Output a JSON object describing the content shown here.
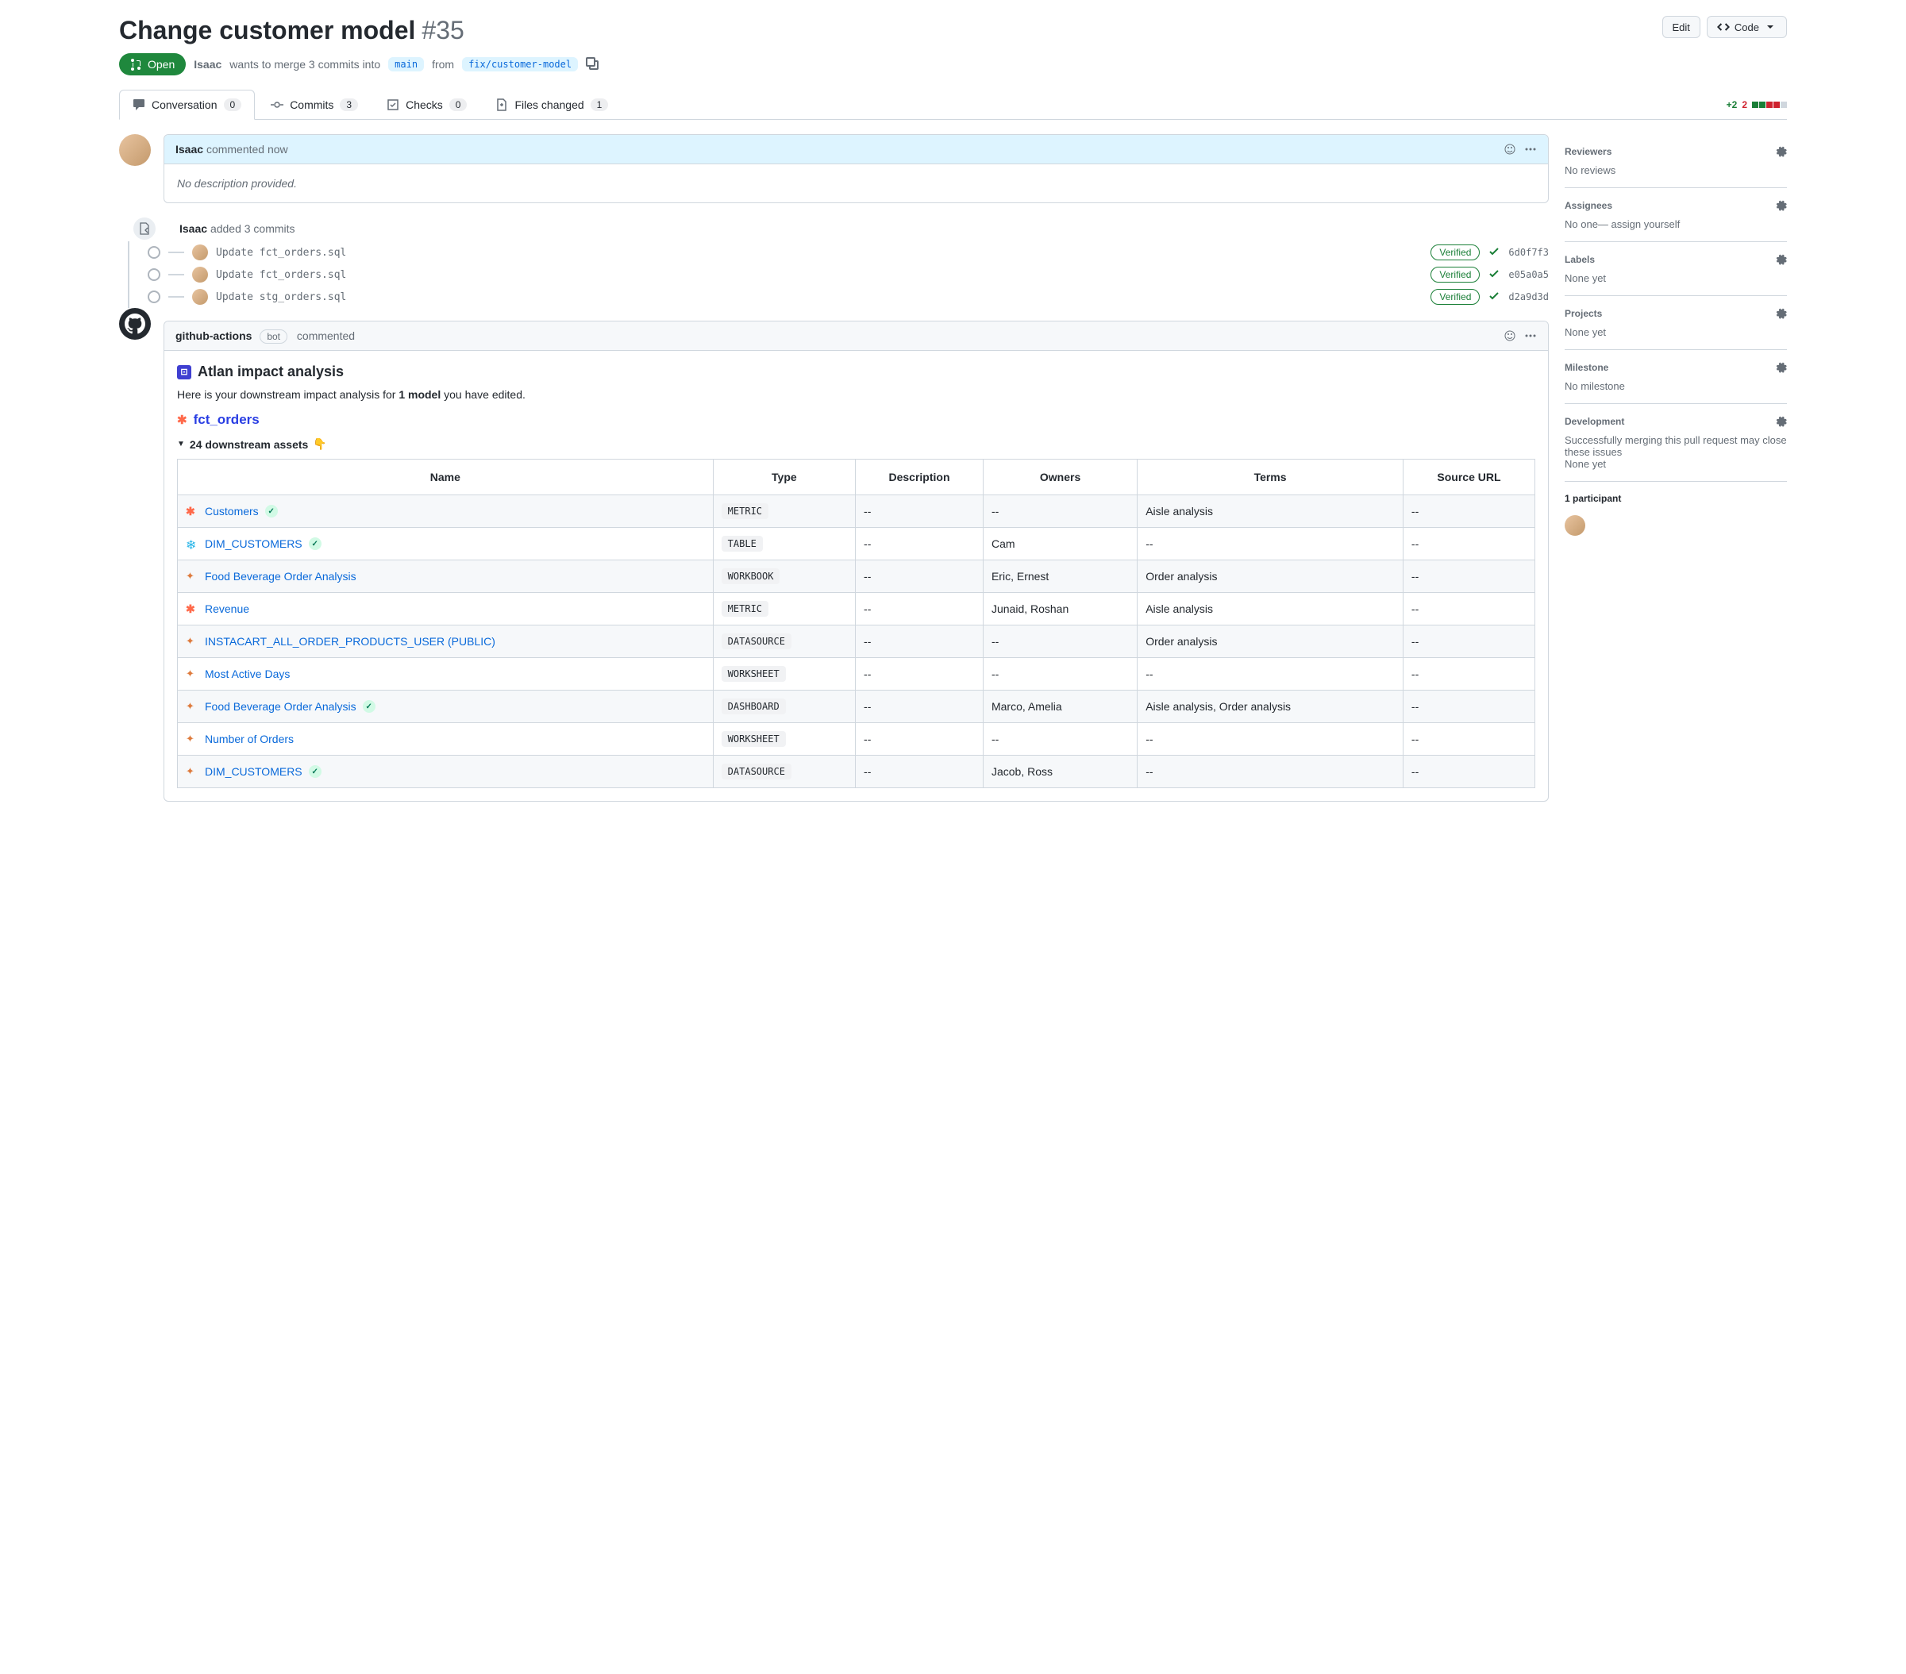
{
  "header": {
    "title": "Change customer model",
    "number": "#35",
    "edit_btn": "Edit",
    "code_btn": "Code",
    "state": "Open",
    "author": "Isaac",
    "merge_text_1": "wants to merge 3 commits into",
    "target_branch": "main",
    "from_text": "from",
    "source_branch": "fix/customer-model"
  },
  "tabs": {
    "conversation": {
      "label": "Conversation",
      "count": "0"
    },
    "commits": {
      "label": "Commits",
      "count": "3"
    },
    "checks": {
      "label": "Checks",
      "count": "0"
    },
    "files": {
      "label": "Files changed",
      "count": "1"
    },
    "diff_add": "+2",
    "diff_del": "2"
  },
  "first_comment": {
    "author": "Isaac",
    "time": "commented now",
    "body": "No description provided."
  },
  "commits_event": {
    "author": "Isaac",
    "text": "added 3 commits"
  },
  "commits": [
    {
      "msg": "Update fct_orders.sql",
      "verified": "Verified",
      "sha": "6d0f7f3"
    },
    {
      "msg": "Update fct_orders.sql",
      "verified": "Verified",
      "sha": "e05a0a5"
    },
    {
      "msg": "Update stg_orders.sql",
      "verified": "Verified",
      "sha": "d2a9d3d"
    }
  ],
  "bot_comment": {
    "author": "github-actions",
    "bot_label": "bot",
    "time": "commented",
    "impact_title": "Atlan impact analysis",
    "impact_desc_1": "Here is your downstream impact analysis for ",
    "impact_desc_strong": "1 model",
    "impact_desc_2": " you have edited.",
    "model_name": "fct_orders",
    "downstream_label": "24 downstream assets",
    "downstream_emoji": "👇"
  },
  "table": {
    "headers": [
      "Name",
      "Type",
      "Description",
      "Owners",
      "Terms",
      "Source URL"
    ],
    "rows": [
      {
        "icon": "orange-x",
        "name": "Customers",
        "verified": true,
        "type": "METRIC",
        "desc": "--",
        "owners": "--",
        "terms": "Aisle analysis",
        "url": "--"
      },
      {
        "icon": "snow",
        "name": "DIM_CUSTOMERS",
        "verified": true,
        "type": "TABLE",
        "desc": "--",
        "owners": "Cam",
        "terms": "--",
        "url": "--"
      },
      {
        "icon": "tbl",
        "name": "Food Beverage Order Analysis",
        "verified": false,
        "type": "WORKBOOK",
        "desc": "--",
        "owners": "Eric, Ernest",
        "terms": "Order analysis",
        "url": "--"
      },
      {
        "icon": "orange-x",
        "name": "Revenue",
        "verified": false,
        "type": "METRIC",
        "desc": "--",
        "owners": "Junaid, Roshan",
        "terms": "Aisle analysis",
        "url": "--"
      },
      {
        "icon": "tbl",
        "name": "INSTACART_ALL_ORDER_PRODUCTS_USER (PUBLIC)",
        "verified": false,
        "type": "DATASOURCE",
        "desc": "--",
        "owners": "--",
        "terms": "Order analysis",
        "url": "--"
      },
      {
        "icon": "tbl",
        "name": "Most Active Days",
        "verified": false,
        "type": "WORKSHEET",
        "desc": "--",
        "owners": "--",
        "terms": "--",
        "url": "--"
      },
      {
        "icon": "tbl",
        "name": "Food Beverage Order Analysis",
        "verified": true,
        "type": "DASHBOARD",
        "desc": "--",
        "owners": "Marco, Amelia",
        "terms": "Aisle analysis, Order analysis",
        "url": "--"
      },
      {
        "icon": "tbl",
        "name": "Number of Orders",
        "verified": false,
        "type": "WORKSHEET",
        "desc": "--",
        "owners": "--",
        "terms": "--",
        "url": "--"
      },
      {
        "icon": "tbl",
        "name": "DIM_CUSTOMERS",
        "verified": true,
        "type": "DATASOURCE",
        "desc": "--",
        "owners": "Jacob, Ross",
        "terms": "--",
        "url": "--"
      }
    ]
  },
  "sidebar": {
    "reviewers": {
      "title": "Reviewers",
      "value": "No reviews"
    },
    "assignees": {
      "title": "Assignees",
      "value_prefix": "No one—",
      "link": " assign yourself"
    },
    "labels": {
      "title": "Labels",
      "value": "None yet"
    },
    "projects": {
      "title": "Projects",
      "value": "None yet"
    },
    "milestone": {
      "title": "Milestone",
      "value": "No milestone"
    },
    "development": {
      "title": "Development",
      "desc": "Successfully merging this pull request may close these issues",
      "value": "None yet"
    },
    "participants": {
      "title": "1 participant"
    }
  }
}
